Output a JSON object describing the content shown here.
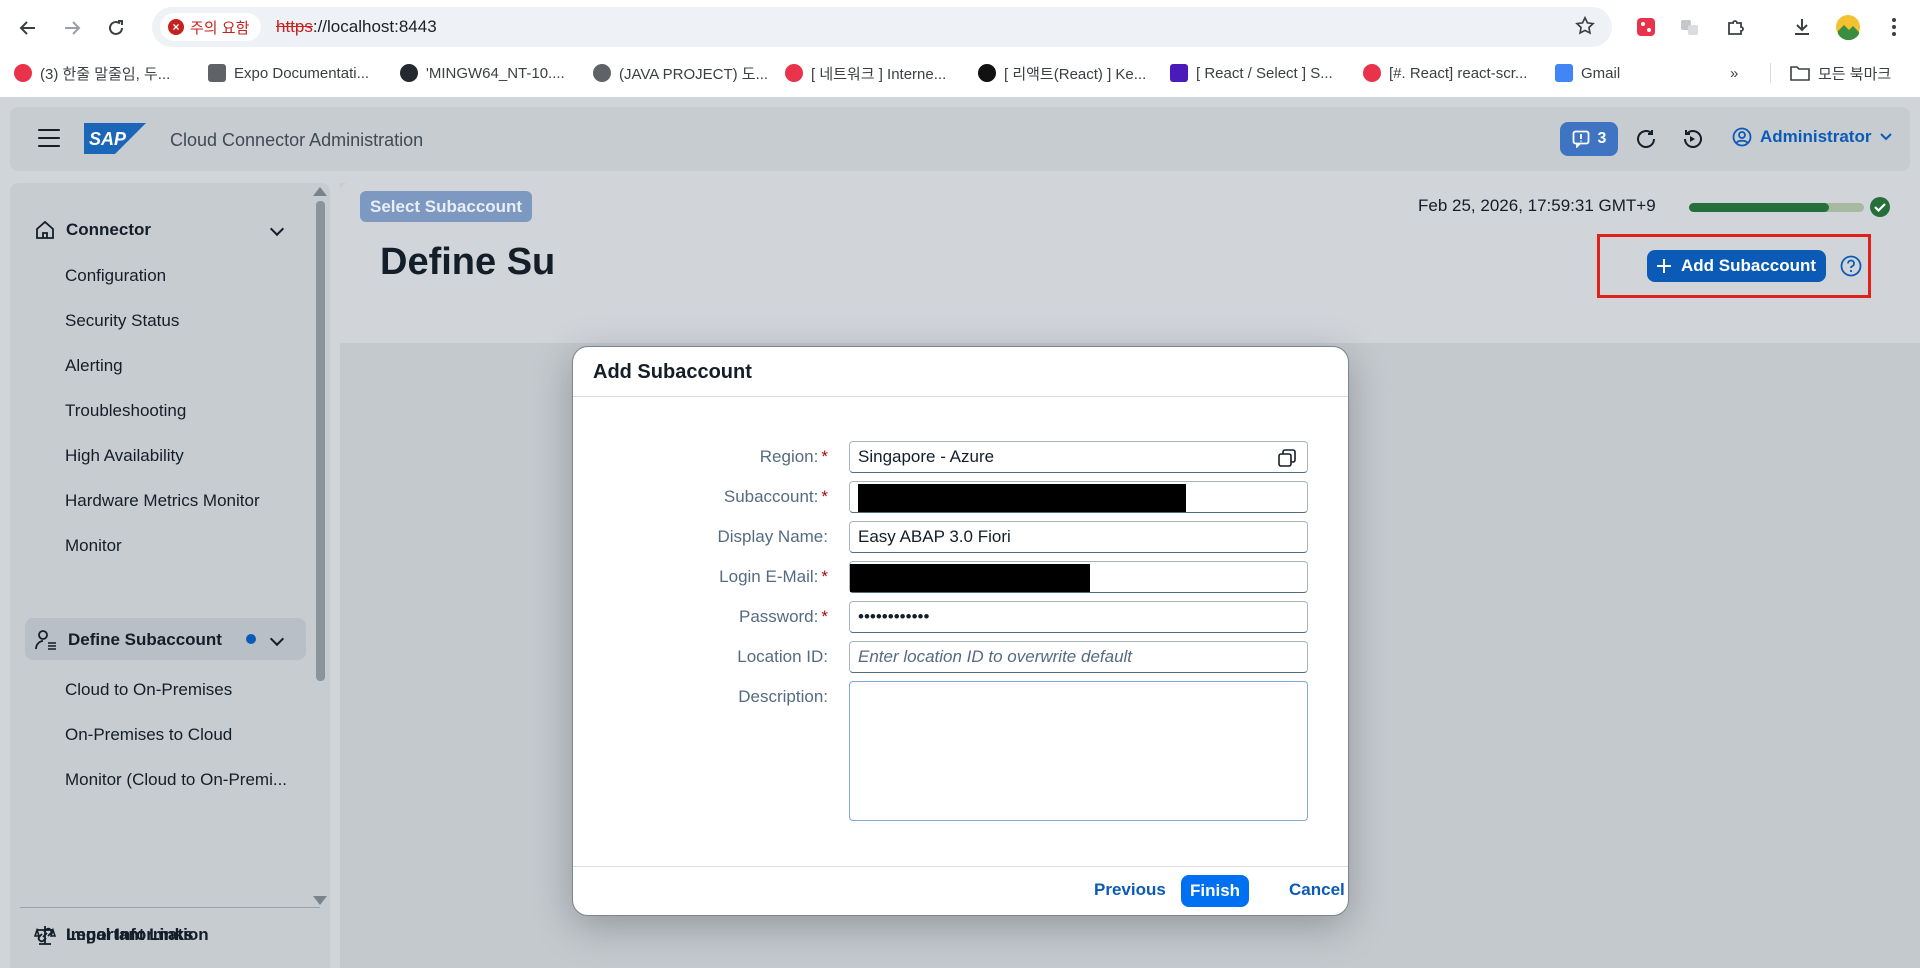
{
  "browser": {
    "security_chip": "주의 요함",
    "url_scheme": "https",
    "url_rest": "://localhost:8443",
    "bookmarks": [
      "(3) 한줄 말줄임, 두...",
      "Expo Documentati...",
      "'MINGW64_NT-10....",
      "(JAVA PROJECT) 도...",
      "[ 네트워크 ] Interne...",
      "[ 리액트(React) ] Ke...",
      "[ React / Select ] S...",
      "[#. React] react-scr...",
      "Gmail"
    ],
    "all_bookmarks": "모든 북마크",
    "more_bookmarks": "»"
  },
  "shell": {
    "title": "Cloud Connector Administration",
    "logo_text": "SAP",
    "notifications_count": "3",
    "user": "Administrator"
  },
  "sidebar": {
    "connector": "Connector",
    "connector_items": [
      "Configuration",
      "Security Status",
      "Alerting",
      "Troubleshooting",
      "High Availability",
      "Hardware Metrics Monitor",
      "Monitor"
    ],
    "define_subaccount": "Define Subaccount",
    "subaccount_items": [
      "Cloud to On-Premises",
      "On-Premises to Cloud",
      "Monitor (Cloud to On-Premi..."
    ],
    "important_links": "Important Links",
    "legal_information": "Legal Information"
  },
  "main": {
    "select_subaccount": "Select Subaccount",
    "timestamp": "Feb 25, 2026, 17:59:31 GMT+9",
    "progress_fraction": 0.8,
    "page_title": "Define Su",
    "add_subaccount": "Add Subaccount"
  },
  "dialog": {
    "title": "Add Subaccount",
    "fields": {
      "region_label": "Region:",
      "region_value": "Singapore - Azure",
      "subaccount_label": "Subaccount:",
      "display_name_label": "Display Name:",
      "display_name_value": "Easy ABAP 3.0 Fiori",
      "login_email_label": "Login E-Mail:",
      "password_label": "Password:",
      "password_value": "••••••••••••",
      "location_id_label": "Location ID:",
      "location_id_placeholder": "Enter location ID to overwrite default",
      "description_label": "Description:"
    },
    "required_marker": "*",
    "previous": "Previous",
    "finish": "Finish",
    "cancel": "Cancel"
  },
  "colors": {
    "accent": "#0b5bb6",
    "emphasized": "#0070f2",
    "required": "#aa0808",
    "highlight_box": "#e0211b",
    "success": "#266f3a"
  }
}
